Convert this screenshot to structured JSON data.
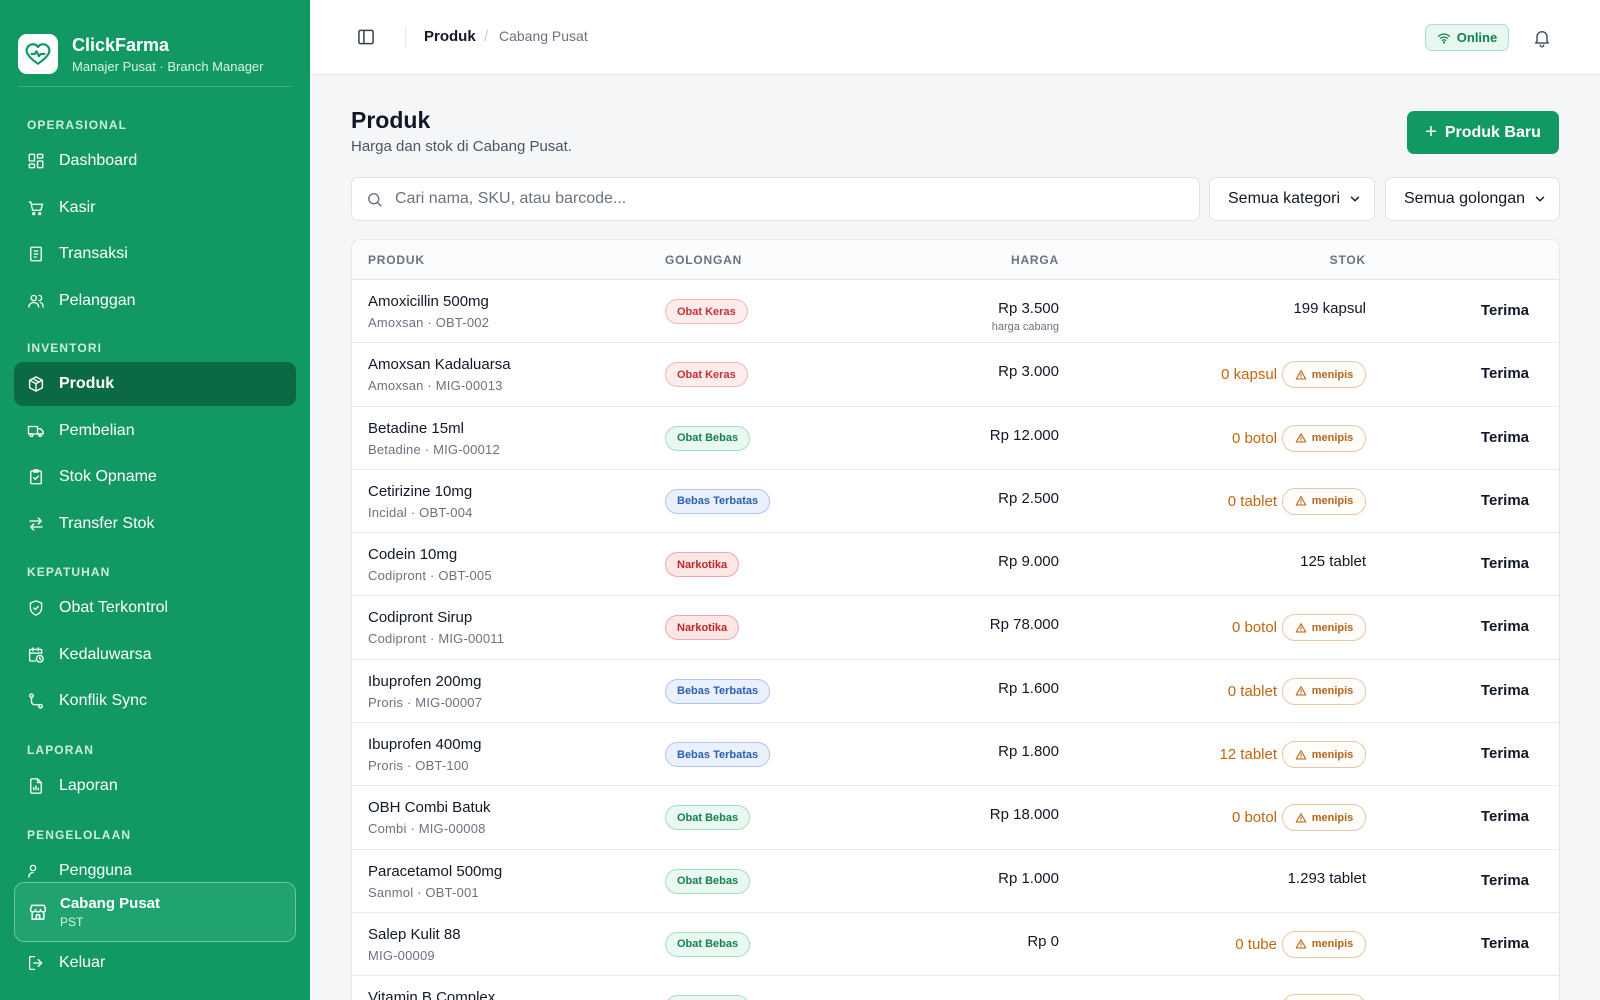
{
  "app": {
    "name": "ClickFarma",
    "role": "Manajer Pusat · Branch Manager"
  },
  "colors": {
    "brand": "#129863",
    "brand_dark": "#0b6a44",
    "warning": "#c2660f"
  },
  "sidebar": {
    "sections": [
      {
        "title": "OPERASIONAL"
      },
      {
        "title": "INVENTORI"
      },
      {
        "title": "KEPATUHAN"
      },
      {
        "title": "LAPORAN"
      },
      {
        "title": "PENGELOLAAN"
      }
    ],
    "items": [
      {
        "label": "Dashboard",
        "icon": "dashboard-icon"
      },
      {
        "label": "Kasir",
        "icon": "cart-icon"
      },
      {
        "label": "Transaksi",
        "icon": "receipt-icon"
      },
      {
        "label": "Pelanggan",
        "icon": "users-icon"
      },
      {
        "label": "Produk",
        "icon": "package-icon",
        "active": true
      },
      {
        "label": "Pembelian",
        "icon": "truck-icon"
      },
      {
        "label": "Stok Opname",
        "icon": "clipboard-check-icon"
      },
      {
        "label": "Transfer Stok",
        "icon": "arrows-exchange-icon"
      },
      {
        "label": "Obat Terkontrol",
        "icon": "shield-check-icon"
      },
      {
        "label": "Kedaluwarsa",
        "icon": "calendar-clock-icon"
      },
      {
        "label": "Konflik Sync",
        "icon": "route-icon"
      },
      {
        "label": "Laporan",
        "icon": "report-chart-icon"
      },
      {
        "label": "Pengguna",
        "icon": "user-key-icon"
      }
    ],
    "branch": {
      "name": "Cabang Pusat",
      "code": "PST"
    },
    "logout": "Keluar"
  },
  "header": {
    "breadcrumb_main": "Produk",
    "breadcrumb_sub": "Cabang Pusat",
    "status": "Online"
  },
  "main": {
    "title": "Produk",
    "subtitle": "Harga dan stok di Cabang Pusat.",
    "new_button": "Produk Baru",
    "search_placeholder": "Cari nama, SKU, atau barcode...",
    "category_filter": "Semua kategori",
    "class_filter": "Semua golongan"
  },
  "table": {
    "columns": [
      "PRODUK",
      "GOLONGAN",
      "HARGA",
      "STOK"
    ],
    "rows": [
      {
        "name": "Amoxicillin 500mg",
        "sub": "Amoxsan · OBT-002",
        "class": "Obat Keras",
        "class_type": "keras",
        "price": "Rp 3.500",
        "price_note": "harga cabang",
        "stock": "199 kapsul",
        "low": false,
        "action": "Terima"
      },
      {
        "name": "Amoxsan Kadaluarsa",
        "sub": "Amoxsan · MIG-00013",
        "class": "Obat Keras",
        "class_type": "keras",
        "price": "Rp 3.000",
        "stock": "0 kapsul",
        "low": true,
        "low_label": "menipis",
        "action": "Terima"
      },
      {
        "name": "Betadine 15ml",
        "sub": "Betadine · MIG-00012",
        "class": "Obat Bebas",
        "class_type": "bebas",
        "price": "Rp 12.000",
        "stock": "0 botol",
        "low": true,
        "low_label": "menipis",
        "action": "Terima"
      },
      {
        "name": "Cetirizine 10mg",
        "sub": "Incidal · OBT-004",
        "class": "Bebas Terbatas",
        "class_type": "terbatas",
        "price": "Rp 2.500",
        "stock": "0 tablet",
        "low": true,
        "low_label": "menipis",
        "action": "Terima"
      },
      {
        "name": "Codein 10mg",
        "sub": "Codipront · OBT-005",
        "class": "Narkotika",
        "class_type": "narkotika",
        "price": "Rp 9.000",
        "stock": "125 tablet",
        "low": false,
        "action": "Terima"
      },
      {
        "name": "Codipront Sirup",
        "sub": "Codipront · MIG-00011",
        "class": "Narkotika",
        "class_type": "narkotika",
        "price": "Rp 78.000",
        "stock": "0 botol",
        "low": true,
        "low_label": "menipis",
        "action": "Terima"
      },
      {
        "name": "Ibuprofen 200mg",
        "sub": "Proris · MIG-00007",
        "class": "Bebas Terbatas",
        "class_type": "terbatas",
        "price": "Rp 1.600",
        "stock": "0 tablet",
        "low": true,
        "low_label": "menipis",
        "action": "Terima"
      },
      {
        "name": "Ibuprofen 400mg",
        "sub": "Proris · OBT-100",
        "class": "Bebas Terbatas",
        "class_type": "terbatas",
        "price": "Rp 1.800",
        "stock": "12 tablet",
        "low": true,
        "low_label": "menipis",
        "action": "Terima"
      },
      {
        "name": "OBH Combi Batuk",
        "sub": "Combi · MIG-00008",
        "class": "Obat Bebas",
        "class_type": "bebas",
        "price": "Rp 18.000",
        "stock": "0 botol",
        "low": true,
        "low_label": "menipis",
        "action": "Terima"
      },
      {
        "name": "Paracetamol 500mg",
        "sub": "Sanmol · OBT-001",
        "class": "Obat Bebas",
        "class_type": "bebas",
        "price": "Rp 1.000",
        "stock": "1.293 tablet",
        "low": false,
        "action": "Terima"
      },
      {
        "name": "Salep Kulit 88",
        "sub": "MIG-00009",
        "class": "Obat Bebas",
        "class_type": "bebas",
        "price": "Rp 0",
        "stock": "0 tube",
        "low": true,
        "low_label": "menipis",
        "action": "Terima"
      },
      {
        "name": "Vitamin B Complex",
        "sub": "",
        "class": "Obat Bebas",
        "class_type": "bebas",
        "price": "",
        "stock": "",
        "low": true,
        "low_label": "",
        "action": ""
      }
    ]
  }
}
